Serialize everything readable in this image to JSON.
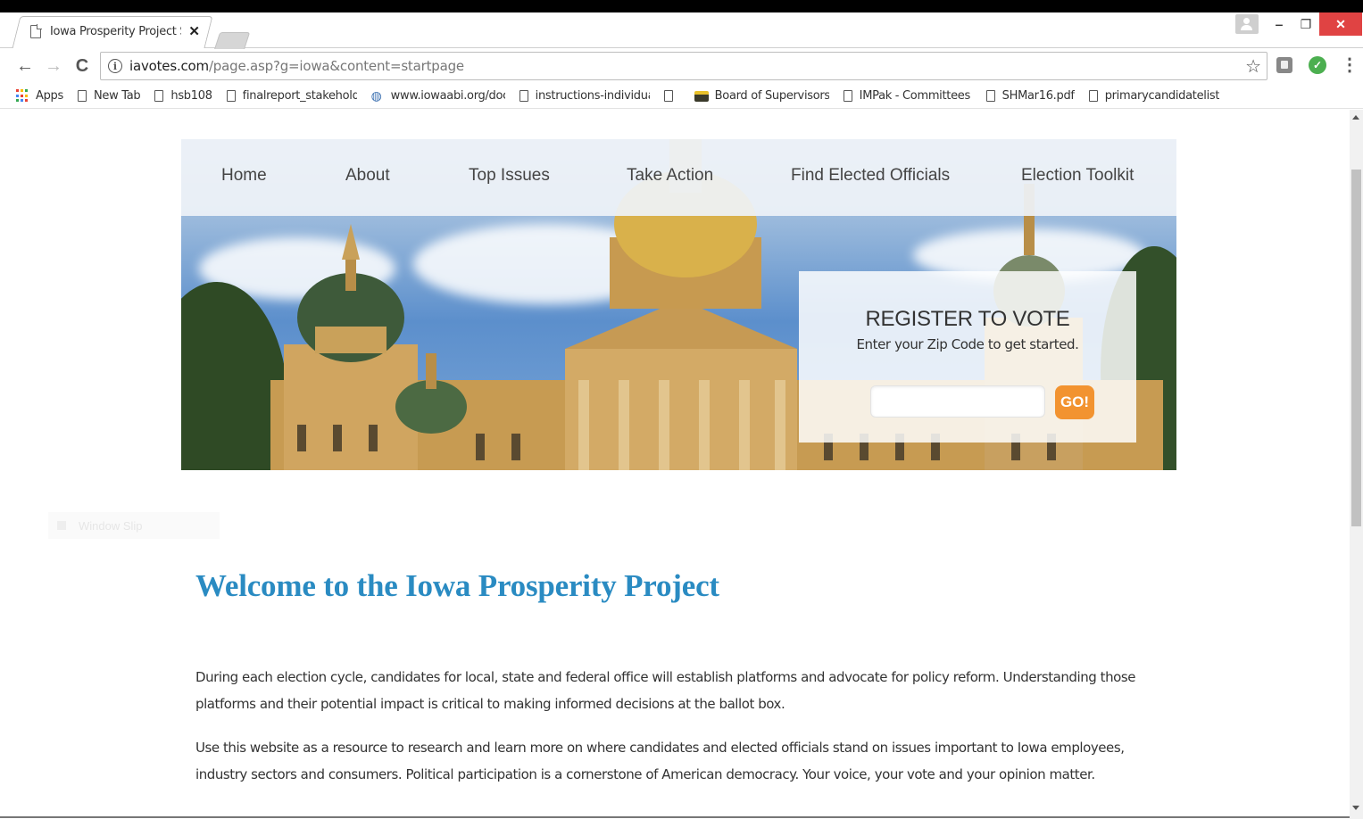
{
  "browser": {
    "tab_title": "Iowa Prosperity Project S",
    "url_host": "iavotes.com",
    "url_path": "/page.asp?g=iowa&content=startpage",
    "bookmarks": [
      {
        "label": "Apps",
        "icon": "apps-grid-icon"
      },
      {
        "label": "New Tab",
        "icon": "page-icon"
      },
      {
        "label": "hsb108",
        "icon": "page-icon"
      },
      {
        "label": "finalreport_stakehold",
        "icon": "page-icon"
      },
      {
        "label": "www.iowaabi.org/doc",
        "icon": "globe-icon"
      },
      {
        "label": "instructions-individua",
        "icon": "page-icon"
      },
      {
        "label": "",
        "icon": "page-icon"
      },
      {
        "label": "Board of Supervisors",
        "icon": "bus-icon"
      },
      {
        "label": "IMPak - Committees",
        "icon": "page-icon"
      },
      {
        "label": "SHMar16.pdf",
        "icon": "page-icon"
      },
      {
        "label": "primarycandidatelist.p",
        "icon": "page-icon"
      }
    ]
  },
  "site": {
    "nav": [
      "Home",
      "About",
      "Top Issues",
      "Take Action",
      "Find Elected Officials",
      "Election Toolkit"
    ],
    "register": {
      "title": "REGISTER TO VOTE",
      "subtitle": "Enter your Zip Code to get started.",
      "zip_value": "",
      "go_label": "GO!"
    },
    "faint_label": "Window Slip",
    "welcome_title": "Welcome to the Iowa Prosperity Project",
    "paragraphs": [
      "During each election cycle, candidates for local, state and federal office will establish platforms and advocate for policy reform. Understanding those platforms and their potential impact is critical to making informed decisions at the ballot box.",
      "Use this website as a resource to research and learn more on where candidates and elected officials stand on issues important to Iowa employees, industry sectors and consumers. Political participation is a cornerstone of American democracy. Your voice, your vote and your opinion matter."
    ]
  },
  "colors": {
    "heading_blue": "#2a8bc2",
    "go_orange": "#f29330",
    "close_red": "#e04343"
  }
}
